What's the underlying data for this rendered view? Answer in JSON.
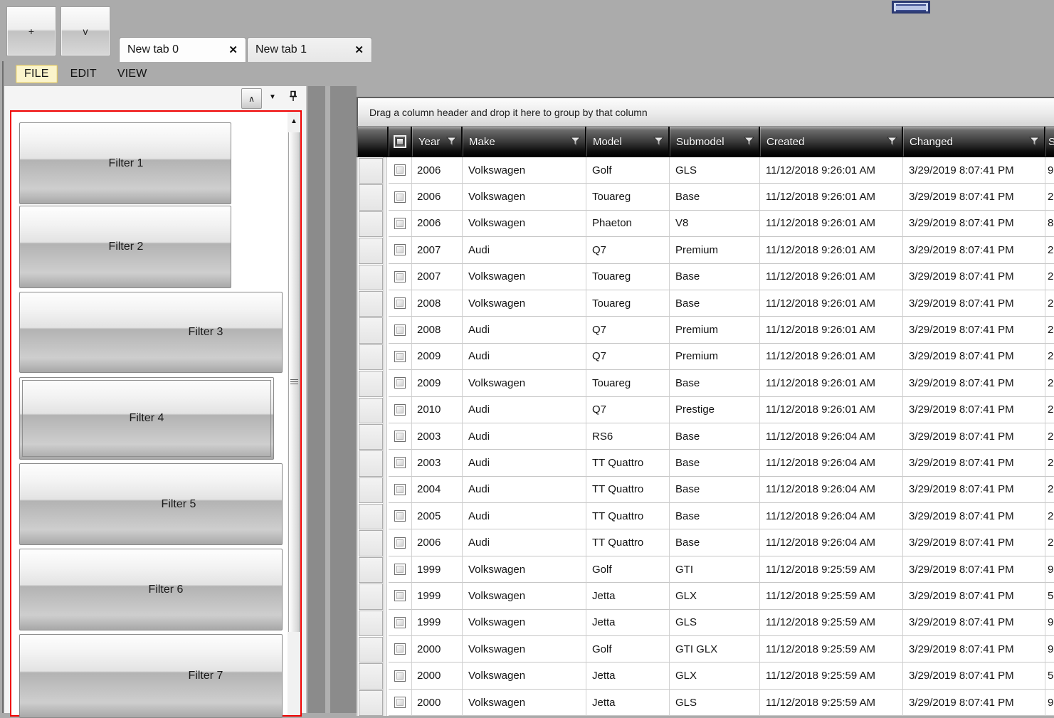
{
  "colors": {
    "window_background": "#ababab",
    "panel_border_red": "#ef0000",
    "grid_header_top": "#a8a8a8",
    "grid_header_bottom": "#000000",
    "menu_highlight_bg": "#fbf4cb",
    "menu_highlight_border": "#d9c36a",
    "widget_blue_fill": "#ccd6ee",
    "widget_blue_border": "#2c3a72"
  },
  "titlebar": {
    "add_tab_button_label": "+",
    "tab_list_button_label": "v",
    "tabs": [
      {
        "label": "New tab 0",
        "close_label": "✕",
        "active": true
      },
      {
        "label": "New tab 1",
        "close_label": "✕",
        "active": false
      }
    ]
  },
  "menubar": {
    "items": [
      {
        "label": "FILE",
        "highlighted": true
      },
      {
        "label": "EDIT",
        "highlighted": false
      },
      {
        "label": "VIEW",
        "highlighted": false
      }
    ]
  },
  "left_panel": {
    "toolbar": {
      "collapse_button_label": "∧",
      "dropdown_icon": "▼",
      "pin_icon": "pin-icon"
    },
    "filters": [
      {
        "label": "Filter 1"
      },
      {
        "label": "Filter 2"
      },
      {
        "label": "Filter 3"
      },
      {
        "label": "Filter 4",
        "focused": true
      },
      {
        "label": "Filter 5"
      },
      {
        "label": "Filter 6"
      },
      {
        "label": "Filter 7"
      }
    ],
    "scrollbar": {
      "up_arrow": "▲"
    }
  },
  "grid": {
    "group_hint": "Drag a column header and drop it here to group by that column",
    "select_all_checkbox_state": "indeterminate",
    "columns": [
      {
        "label": "Year",
        "has_filter": true
      },
      {
        "label": "Make",
        "has_filter": true
      },
      {
        "label": "Model",
        "has_filter": true
      },
      {
        "label": "Submodel",
        "has_filter": true
      },
      {
        "label": "Created",
        "has_filter": true
      },
      {
        "label": "Changed",
        "has_filter": true
      },
      {
        "label": "S",
        "has_filter": false,
        "partial": true
      }
    ],
    "rows": [
      {
        "checked": false,
        "year": "2006",
        "make": "Volkswagen",
        "model": "Golf",
        "submodel": "GLS",
        "created": "11/12/2018 9:26:01 AM",
        "changed": "3/29/2019 8:07:41 PM",
        "price_start": "9"
      },
      {
        "checked": false,
        "year": "2006",
        "make": "Volkswagen",
        "model": "Touareg",
        "submodel": "Base",
        "created": "11/12/2018 9:26:01 AM",
        "changed": "3/29/2019 8:07:41 PM",
        "price_start": "2"
      },
      {
        "checked": false,
        "year": "2006",
        "make": "Volkswagen",
        "model": "Phaeton",
        "submodel": "V8",
        "created": "11/12/2018 9:26:01 AM",
        "changed": "3/29/2019 8:07:41 PM",
        "price_start": "8"
      },
      {
        "checked": false,
        "year": "2007",
        "make": "Audi",
        "model": "Q7",
        "submodel": "Premium",
        "created": "11/12/2018 9:26:01 AM",
        "changed": "3/29/2019 8:07:41 PM",
        "price_start": "2"
      },
      {
        "checked": false,
        "year": "2007",
        "make": "Volkswagen",
        "model": "Touareg",
        "submodel": "Base",
        "created": "11/12/2018 9:26:01 AM",
        "changed": "3/29/2019 8:07:41 PM",
        "price_start": "2"
      },
      {
        "checked": false,
        "year": "2008",
        "make": "Volkswagen",
        "model": "Touareg",
        "submodel": "Base",
        "created": "11/12/2018 9:26:01 AM",
        "changed": "3/29/2019 8:07:41 PM",
        "price_start": "2"
      },
      {
        "checked": false,
        "year": "2008",
        "make": "Audi",
        "model": "Q7",
        "submodel": "Premium",
        "created": "11/12/2018 9:26:01 AM",
        "changed": "3/29/2019 8:07:41 PM",
        "price_start": "2"
      },
      {
        "checked": false,
        "year": "2009",
        "make": "Audi",
        "model": "Q7",
        "submodel": "Premium",
        "created": "11/12/2018 9:26:01 AM",
        "changed": "3/29/2019 8:07:41 PM",
        "price_start": "2"
      },
      {
        "checked": false,
        "year": "2009",
        "make": "Volkswagen",
        "model": "Touareg",
        "submodel": "Base",
        "created": "11/12/2018 9:26:01 AM",
        "changed": "3/29/2019 8:07:41 PM",
        "price_start": "2"
      },
      {
        "checked": false,
        "year": "2010",
        "make": "Audi",
        "model": "Q7",
        "submodel": "Prestige",
        "created": "11/12/2018 9:26:01 AM",
        "changed": "3/29/2019 8:07:41 PM",
        "price_start": "2"
      },
      {
        "checked": false,
        "year": "2003",
        "make": "Audi",
        "model": "RS6",
        "submodel": "Base",
        "created": "11/12/2018 9:26:04 AM",
        "changed": "3/29/2019 8:07:41 PM",
        "price_start": "2"
      },
      {
        "checked": false,
        "year": "2003",
        "make": "Audi",
        "model": "TT Quattro",
        "submodel": "Base",
        "created": "11/12/2018 9:26:04 AM",
        "changed": "3/29/2019 8:07:41 PM",
        "price_start": "2"
      },
      {
        "checked": false,
        "year": "2004",
        "make": "Audi",
        "model": "TT Quattro",
        "submodel": "Base",
        "created": "11/12/2018 9:26:04 AM",
        "changed": "3/29/2019 8:07:41 PM",
        "price_start": "2"
      },
      {
        "checked": false,
        "year": "2005",
        "make": "Audi",
        "model": "TT Quattro",
        "submodel": "Base",
        "created": "11/12/2018 9:26:04 AM",
        "changed": "3/29/2019 8:07:41 PM",
        "price_start": "2"
      },
      {
        "checked": false,
        "year": "2006",
        "make": "Audi",
        "model": "TT Quattro",
        "submodel": "Base",
        "created": "11/12/2018 9:26:04 AM",
        "changed": "3/29/2019 8:07:41 PM",
        "price_start": "2"
      },
      {
        "checked": false,
        "year": "1999",
        "make": "Volkswagen",
        "model": "Golf",
        "submodel": "GTI",
        "created": "11/12/2018 9:25:59 AM",
        "changed": "3/29/2019 8:07:41 PM",
        "price_start": "9"
      },
      {
        "checked": false,
        "year": "1999",
        "make": "Volkswagen",
        "model": "Jetta",
        "submodel": "GLX",
        "created": "11/12/2018 9:25:59 AM",
        "changed": "3/29/2019 8:07:41 PM",
        "price_start": "5"
      },
      {
        "checked": false,
        "year": "1999",
        "make": "Volkswagen",
        "model": "Jetta",
        "submodel": "GLS",
        "created": "11/12/2018 9:25:59 AM",
        "changed": "3/29/2019 8:07:41 PM",
        "price_start": "9"
      },
      {
        "checked": false,
        "year": "2000",
        "make": "Volkswagen",
        "model": "Golf",
        "submodel": "GTI GLX",
        "created": "11/12/2018 9:25:59 AM",
        "changed": "3/29/2019 8:07:41 PM",
        "price_start": "9"
      },
      {
        "checked": false,
        "year": "2000",
        "make": "Volkswagen",
        "model": "Jetta",
        "submodel": "GLX",
        "created": "11/12/2018 9:25:59 AM",
        "changed": "3/29/2019 8:07:41 PM",
        "price_start": "5"
      },
      {
        "checked": false,
        "year": "2000",
        "make": "Volkswagen",
        "model": "Jetta",
        "submodel": "GLS",
        "created": "11/12/2018 9:25:59 AM",
        "changed": "3/29/2019 8:07:41 PM",
        "price_start": "9"
      }
    ]
  }
}
